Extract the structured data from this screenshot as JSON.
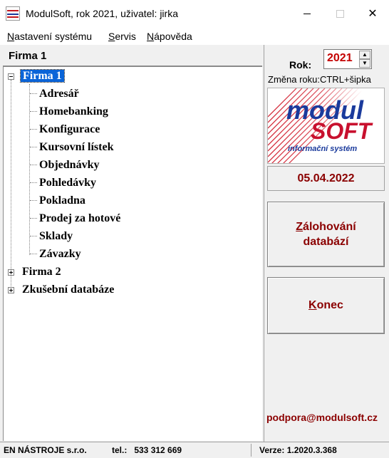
{
  "window": {
    "title": "ModulSoft, rok 2021, uživatel: jirka",
    "close_glyph": "✕"
  },
  "menu": [
    {
      "label_underlined": "N",
      "label_rest": "astavení systému"
    },
    {
      "label_underlined": "S",
      "label_rest": "ervis"
    },
    {
      "label_underlined": "N",
      "label_rest": "ápověda"
    }
  ],
  "left_panel": {
    "header": "Firma 1"
  },
  "tree": {
    "root1": "Firma 1",
    "children": [
      "Adresář",
      "Homebanking",
      "Konfigurace",
      "Kursovní lístek",
      "Objednávky",
      "Pohledávky",
      "Pokladna",
      "Prodej za hotové",
      "Sklady",
      "Závazky"
    ],
    "root2": "Firma 2",
    "root3": "Zkušební databáze"
  },
  "year": {
    "label": "Rok:",
    "value": "2021",
    "hint": "Změna roku:CTRL+šipka",
    "up_glyph": "▲",
    "down_glyph": "▼"
  },
  "logo": {
    "modul": "modul",
    "soft": "SOFT",
    "subtitle": "informační systém"
  },
  "date": "05.04.2022",
  "buttons": {
    "backup_line1_underlined": "Z",
    "backup_line1_rest": "álohování",
    "backup_line2": "databází",
    "exit_underlined": "K",
    "exit_rest": "onec"
  },
  "support_email": "podpora@modulsoft.cz",
  "status": {
    "company": "EN NÁSTROJE s.r.o.",
    "phone": "tel.:   533 312 669",
    "version": "Verze: 1.2020.3.368"
  },
  "colors": {
    "accent_red": "#8b0000",
    "selection_blue": "#0a64d8",
    "year_red": "#c40000"
  }
}
